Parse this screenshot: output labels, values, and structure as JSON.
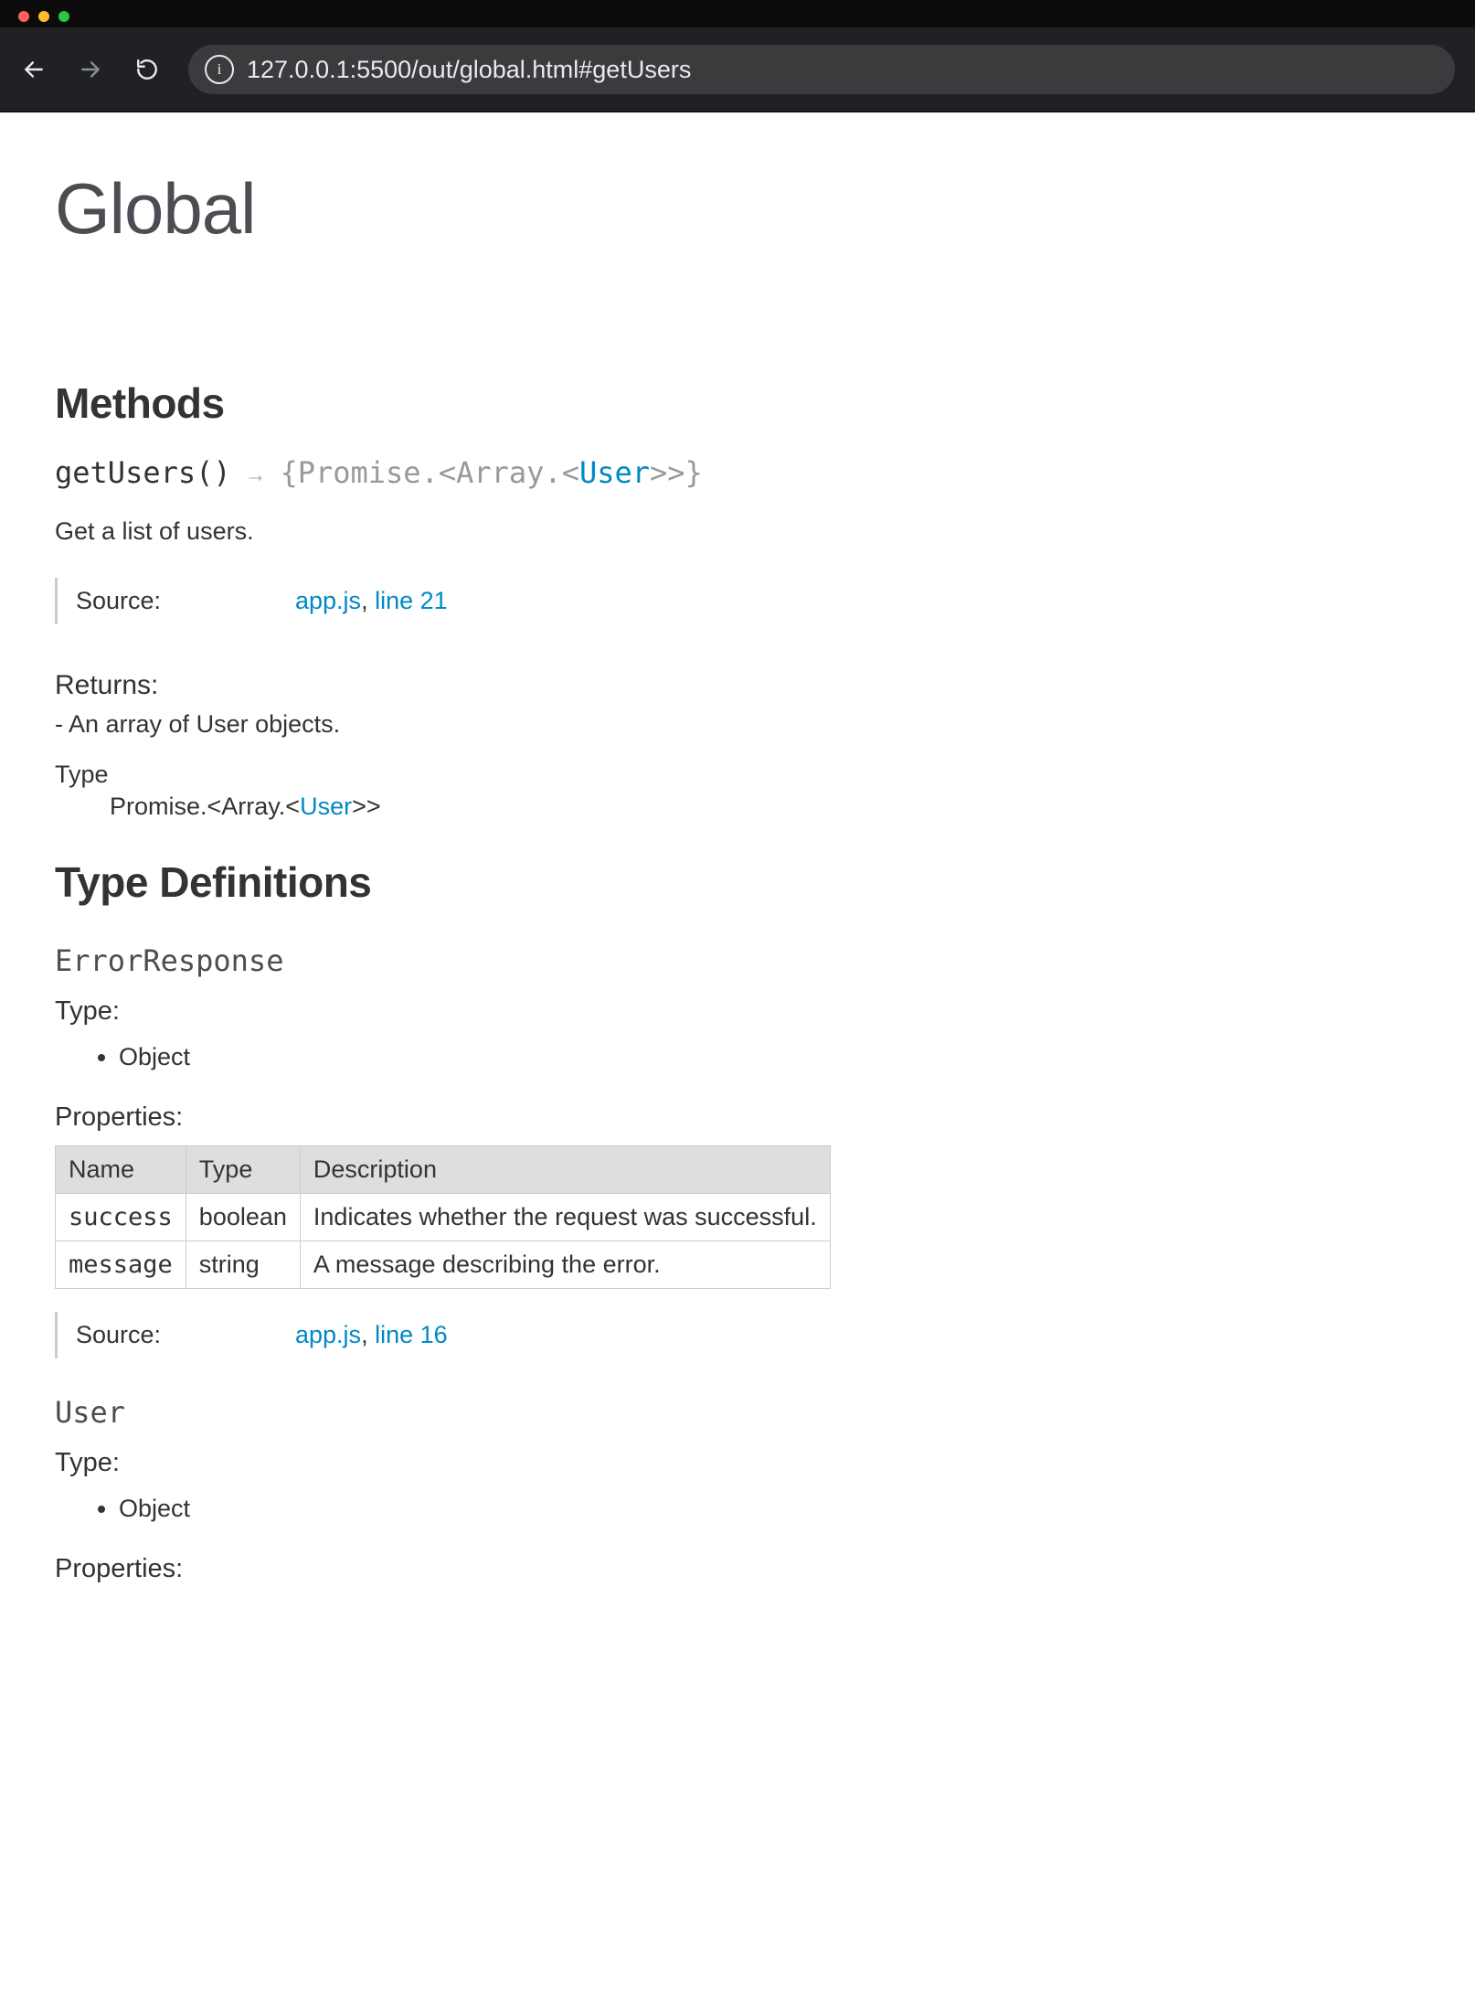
{
  "browser": {
    "url": "127.0.0.1:5500/out/global.html#getUsers"
  },
  "page": {
    "title": "Global"
  },
  "methods": {
    "heading": "Methods",
    "items": [
      {
        "name": "getUsers()",
        "arrow": "→",
        "returns_sig_prefix": "{Promise.<Array.<",
        "returns_sig_link": "User",
        "returns_sig_suffix": ">>}",
        "description": "Get a list of users.",
        "source_label": "Source:",
        "source_file": "app.js",
        "source_sep": ", ",
        "source_line": "line 21",
        "returns_heading": "Returns:",
        "returns_desc": "- An array of User objects.",
        "type_label": "Type",
        "type_prefix": "Promise.<Array.<",
        "type_link": "User",
        "type_suffix": ">>"
      }
    ]
  },
  "typedefs": {
    "heading": "Type Definitions",
    "items": [
      {
        "name": "ErrorResponse",
        "type_heading": "Type:",
        "type_items": [
          "Object"
        ],
        "props_heading": "Properties:",
        "props_headers": {
          "name": "Name",
          "type": "Type",
          "desc": "Description"
        },
        "props": [
          {
            "name": "success",
            "type": "boolean",
            "desc": "Indicates whether the request was successful."
          },
          {
            "name": "message",
            "type": "string",
            "desc": "A message describing the error."
          }
        ],
        "source_label": "Source:",
        "source_file": "app.js",
        "source_sep": ", ",
        "source_line": "line 16"
      },
      {
        "name": "User",
        "type_heading": "Type:",
        "type_items": [
          "Object"
        ],
        "props_heading": "Properties:"
      }
    ]
  }
}
